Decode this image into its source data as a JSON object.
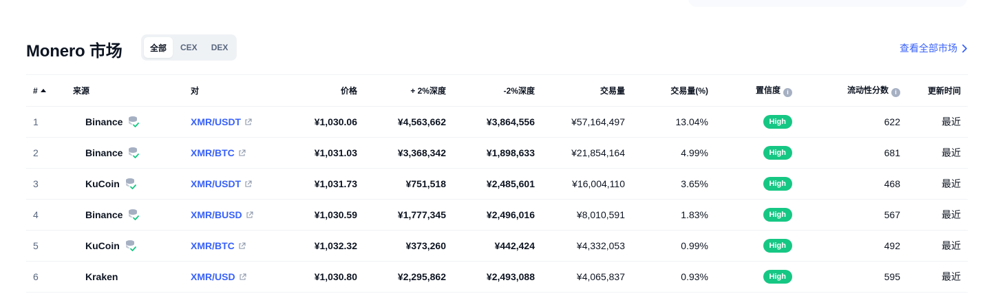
{
  "header": {
    "title": "Monero 市场",
    "tabs": [
      {
        "label": "全部",
        "active": true
      },
      {
        "label": "CEX",
        "active": false
      },
      {
        "label": "DEX",
        "active": false
      }
    ],
    "view_all": "查看全部市场"
  },
  "table": {
    "columns": {
      "rank": "#",
      "source": "来源",
      "pair": "对",
      "price": "价格",
      "depth_plus": "+ 2%深度",
      "depth_minus": "-2%深度",
      "volume": "交易量",
      "volume_pct": "交易量(%)",
      "confidence": "置信度",
      "liquidity": "流动性分数",
      "updated": "更新时间"
    },
    "rows": [
      {
        "rank": "1",
        "source": "Binance",
        "pair": "XMR/USDT",
        "price": "¥1,030.06",
        "depth_plus": "¥4,563,662",
        "depth_minus": "¥3,864,556",
        "volume": "¥57,164,497",
        "volume_pct": "13.04%",
        "confidence": "High",
        "liquidity": "622",
        "updated": "最近"
      },
      {
        "rank": "2",
        "source": "Binance",
        "pair": "XMR/BTC",
        "price": "¥1,031.03",
        "depth_plus": "¥3,368,342",
        "depth_minus": "¥1,898,633",
        "volume": "¥21,854,164",
        "volume_pct": "4.99%",
        "confidence": "High",
        "liquidity": "681",
        "updated": "最近"
      },
      {
        "rank": "3",
        "source": "KuCoin",
        "pair": "XMR/USDT",
        "price": "¥1,031.73",
        "depth_plus": "¥751,518",
        "depth_minus": "¥2,485,601",
        "volume": "¥16,004,110",
        "volume_pct": "3.65%",
        "confidence": "High",
        "liquidity": "468",
        "updated": "最近"
      },
      {
        "rank": "4",
        "source": "Binance",
        "pair": "XMR/BUSD",
        "price": "¥1,030.59",
        "depth_plus": "¥1,777,345",
        "depth_minus": "¥2,496,016",
        "volume": "¥8,010,591",
        "volume_pct": "1.83%",
        "confidence": "High",
        "liquidity": "567",
        "updated": "最近"
      },
      {
        "rank": "5",
        "source": "KuCoin",
        "pair": "XMR/BTC",
        "price": "¥1,032.32",
        "depth_plus": "¥373,260",
        "depth_minus": "¥442,424",
        "volume": "¥4,332,053",
        "volume_pct": "0.99%",
        "confidence": "High",
        "liquidity": "492",
        "updated": "最近"
      },
      {
        "rank": "6",
        "source": "Kraken",
        "pair": "XMR/USD",
        "price": "¥1,030.80",
        "depth_plus": "¥2,295,862",
        "depth_minus": "¥2,493,088",
        "volume": "¥4,065,837",
        "volume_pct": "0.93%",
        "confidence": "High",
        "liquidity": "595",
        "updated": "最近"
      }
    ],
    "verified_icon_rows": [
      0,
      1,
      2,
      3,
      4
    ]
  },
  "colors": {
    "accent": "#3861fb",
    "high_badge": "#16c784",
    "muted": "#58667e"
  }
}
